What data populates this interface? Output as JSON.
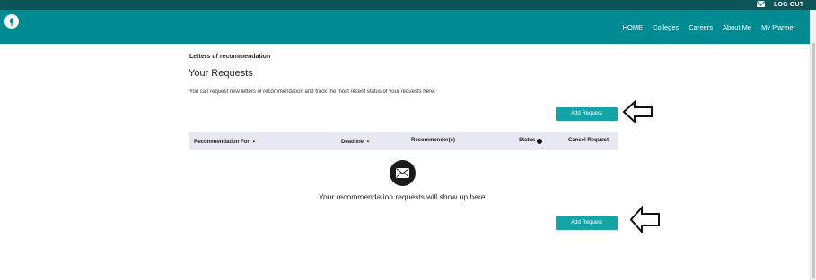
{
  "topbar": {
    "logout_label": "LOG OUT",
    "mail_icon": "envelope-icon"
  },
  "header": {
    "logo_icon": "leaf-logo-icon",
    "nav": [
      "HOME",
      "Colleges",
      "Careers",
      "About Me",
      "My Planner"
    ]
  },
  "page": {
    "breadcrumb": "Letters of recommendation",
    "title": "Your Requests",
    "intro": "You can request new letters of recommendation and track the most recent status of your requests here.",
    "add_request_label": "Add Request"
  },
  "table": {
    "columns": {
      "recommendation_for": "Recommendation For",
      "deadline": "Deadline",
      "recommenders": "Recommender(s)",
      "status": "Status",
      "cancel": "Cancel Request"
    },
    "sort_icon": "caret-up-icon",
    "info_icon": "info-icon"
  },
  "empty_state": {
    "icon": "envelope-icon",
    "message": "Your recommendation requests will show up here."
  },
  "colors": {
    "topstrip": "#0b5458",
    "navbar": "#008a91",
    "button": "#14a3a7",
    "table_header": "#e8e8f2"
  }
}
